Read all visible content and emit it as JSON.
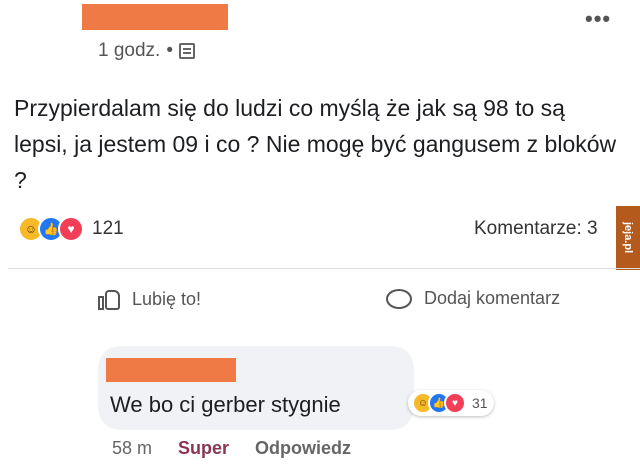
{
  "post": {
    "author_redaction_color": "#f07a45",
    "time": "1 godz.",
    "separator": "•",
    "audience_icon": "friends-icon",
    "more_icon": "•••",
    "text": "Przypierdalam się do ludzi co myślą że jak są 98 to są lepsi, ja jestem 09 i co ? Nie mogę być gangusem z bloków ?",
    "reaction_count": "121",
    "comments_label": "Komentarze: 3",
    "reaction_icons": [
      "haha-icon",
      "like-icon",
      "love-icon"
    ]
  },
  "actions": {
    "like_label": "Lubię to!",
    "comment_label": "Dodaj komentarz"
  },
  "watermark": "jeja.pl",
  "comment": {
    "text": "We bo ci gerber stygnie",
    "reaction_count": "31",
    "time": "58 m",
    "reaction_label": "Super",
    "reply_label": "Odpowiedz"
  }
}
